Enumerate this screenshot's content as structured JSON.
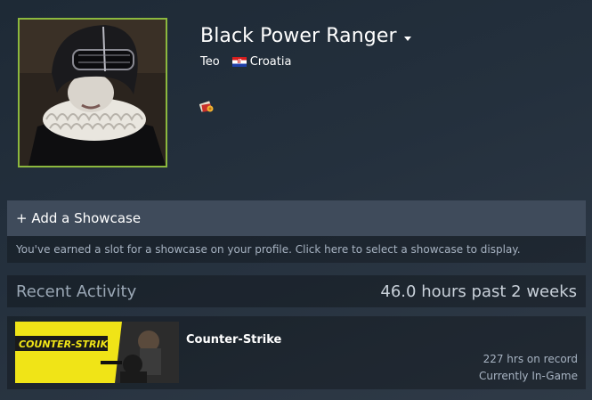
{
  "profile": {
    "persona_name": "Black Power Ranger",
    "real_name": "Teo",
    "country": "Croatia"
  },
  "showcase": {
    "title": "+ Add a Showcase",
    "description": "You've earned a slot for a showcase on your profile. Click here to select a showcase to display."
  },
  "recent_activity": {
    "title": "Recent Activity",
    "hours_summary": "46.0 hours past 2 weeks"
  },
  "games": [
    {
      "name": "Counter-Strike",
      "capsule_logo": "COUNTER-STRIKE",
      "hours": "227 hrs on record",
      "status": "Currently In-Game"
    }
  ],
  "colors": {
    "avatar_border": "#8cb83e",
    "panel_header": "#3f4b5b",
    "muted_text": "#a7b3c2"
  }
}
